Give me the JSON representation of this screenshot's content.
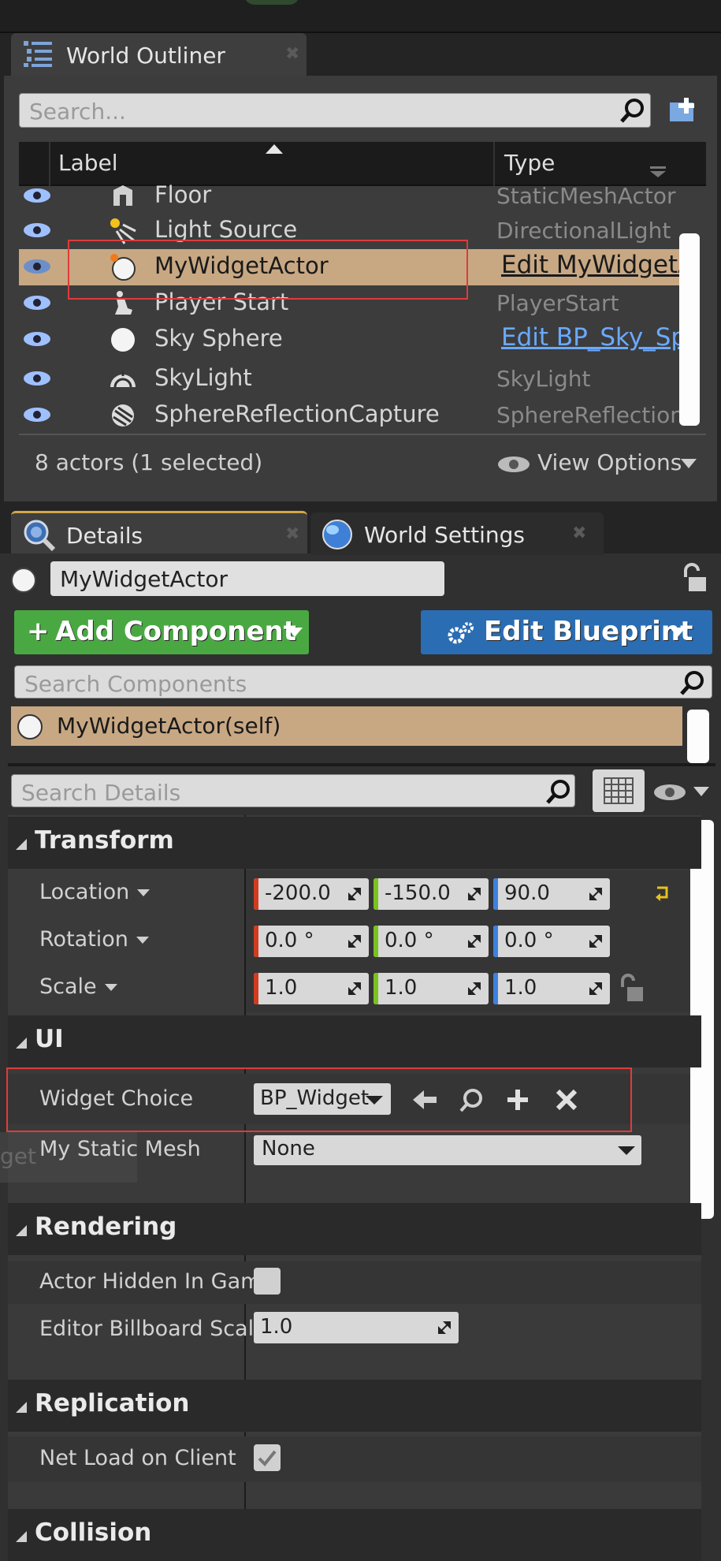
{
  "outliner": {
    "tab_title": "World Outliner",
    "search_placeholder": "Search...",
    "columns": {
      "label": "Label",
      "type": "Type"
    },
    "rows": [
      {
        "label": "Floor",
        "type": "StaticMeshActor",
        "icon": "floor-icon"
      },
      {
        "label": "Light Source",
        "type": "DirectionalLight",
        "icon": "light-source-icon"
      },
      {
        "label": "MyWidgetActor",
        "type": "Edit MyWidgetActor",
        "icon": "sphere-icon",
        "selected": true
      },
      {
        "label": "Player Start",
        "type": "PlayerStart",
        "icon": "player-start-icon"
      },
      {
        "label": "Sky Sphere",
        "type": "Edit BP_Sky_Sphere",
        "icon": "sphere-icon"
      },
      {
        "label": "SkyLight",
        "type": "SkyLight",
        "icon": "skylight-icon"
      },
      {
        "label": "SphereReflectionCapture",
        "type": "SphereReflectionCapture",
        "icon": "reflection-capture-icon"
      }
    ],
    "status": "8 actors (1 selected)",
    "view_options": "View Options"
  },
  "details": {
    "tab_title": "Details",
    "world_settings_tab": "World Settings",
    "actor_name": "MyWidgetActor",
    "add_component": "Add Component",
    "edit_blueprint": "Edit Blueprint",
    "search_components_placeholder": "Search Components",
    "component_self": "MyWidgetActor(self)",
    "search_details_placeholder": "Search Details",
    "sections": {
      "transform": "Transform",
      "ui": "UI",
      "rendering": "Rendering",
      "replication": "Replication",
      "collision": "Collision"
    },
    "transform": {
      "location_label": "Location",
      "rotation_label": "Rotation",
      "scale_label": "Scale",
      "location": [
        "-200.0",
        "-150.0",
        "90.0"
      ],
      "rotation": [
        "0.0 °",
        "0.0 °",
        "0.0 °"
      ],
      "scale": [
        "1.0",
        "1.0",
        "1.0"
      ]
    },
    "ui": {
      "widget_choice_label": "Widget Choice",
      "widget_choice_value": "BP_Widget",
      "static_mesh_label": "My Static Mesh",
      "static_mesh_value": "None",
      "ghost_text": "get"
    },
    "rendering": {
      "hidden_label": "Actor Hidden In Game",
      "billboard_label": "Editor Billboard Scale",
      "billboard_value": "1.0"
    },
    "replication": {
      "net_load_label": "Net Load on Client"
    }
  },
  "colors": {
    "x_axis": "#d13b1f",
    "y_axis": "#7ac21e",
    "z_axis": "#3b82e0",
    "selection": "#c8a883",
    "green_button": "#4aa843",
    "blue_button": "#2b6db3"
  }
}
